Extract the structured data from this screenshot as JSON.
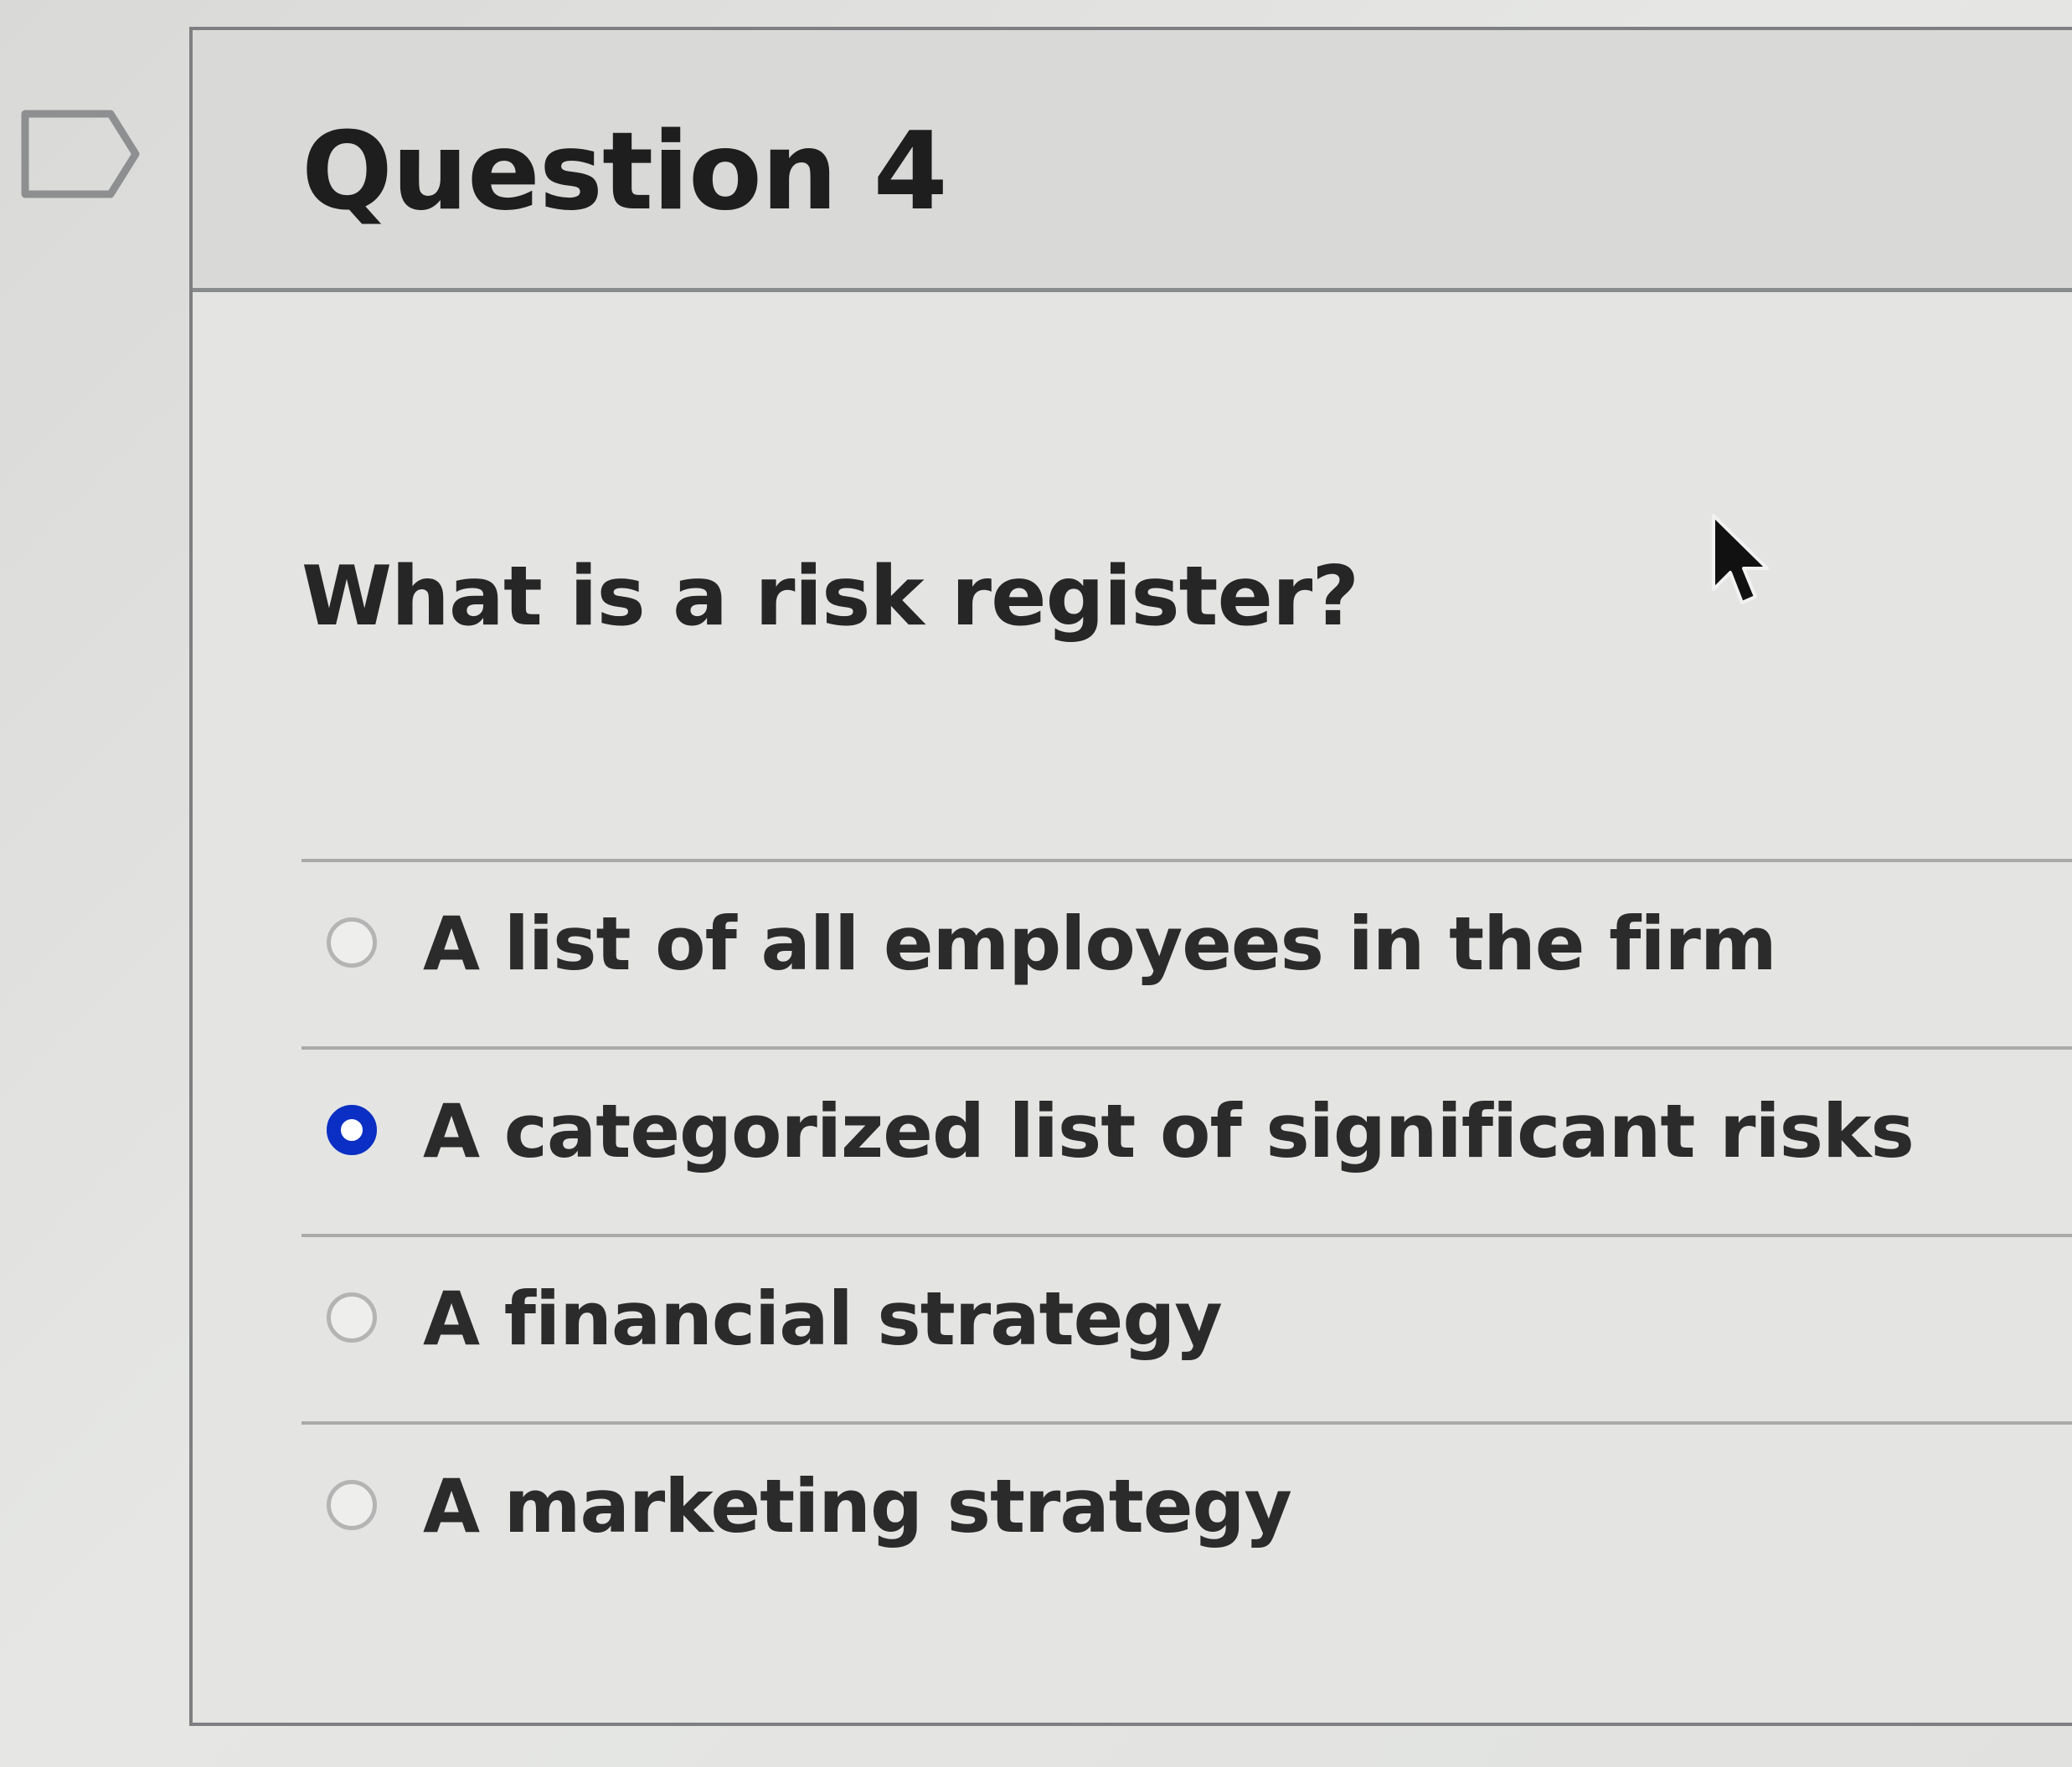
{
  "question": {
    "title": "Question 4",
    "text": "What is a risk register?"
  },
  "answers": [
    {
      "label": "A list of all employees in the firm",
      "selected": false
    },
    {
      "label": "A categorized list of significant risks",
      "selected": true
    },
    {
      "label": "A financial strategy",
      "selected": false
    },
    {
      "label": "A marketing strategy",
      "selected": false
    }
  ],
  "colors": {
    "selected_radio": "#0b2fc4",
    "text": "#2b2b2c",
    "divider": "#a9aaa9"
  },
  "icons": {
    "flag": "flag-question-icon",
    "cursor": "mouse-pointer-icon"
  }
}
